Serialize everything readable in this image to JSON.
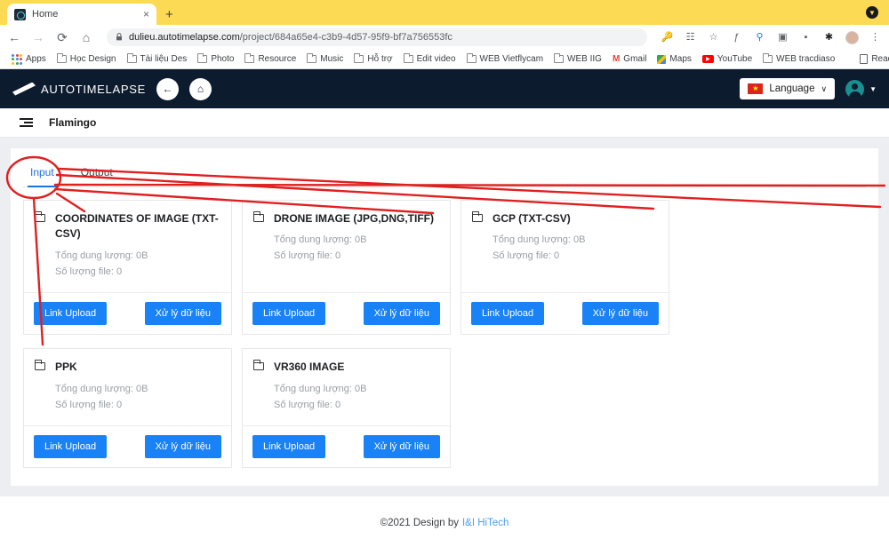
{
  "browser": {
    "tab": {
      "title": "Home",
      "favicon": "globe-icon",
      "close": "×"
    },
    "new_tab": "+",
    "window_menu": "▼",
    "nav": {
      "back": "←",
      "forward": "→",
      "reload": "⟳",
      "home": "⌂"
    },
    "omnibox": {
      "lock": "🔒",
      "host": "dulieu.autotimelapse.com",
      "path": "/project/684a65e4-c3b9-4d57-95f9-bf7a756553fc"
    },
    "toolbar_icons": [
      "key-icon",
      "translate-icon",
      "star-icon",
      "f-script-icon",
      "search-image-icon",
      "camera-icon",
      "paint-icon",
      "extensions-icon",
      "profile-avatar-icon",
      "more-menu-icon"
    ],
    "bookmarks": [
      {
        "label": "Apps",
        "icon": "apps-grid-icon"
      },
      {
        "label": "Học Design",
        "icon": "folder-icon"
      },
      {
        "label": "Tài liệu Des",
        "icon": "folder-icon"
      },
      {
        "label": "Photo",
        "icon": "folder-icon"
      },
      {
        "label": "Resource",
        "icon": "folder-icon"
      },
      {
        "label": "Music",
        "icon": "folder-icon"
      },
      {
        "label": "Hỗ trợ",
        "icon": "folder-icon"
      },
      {
        "label": "Edit video",
        "icon": "folder-icon"
      },
      {
        "label": "WEB Vietflycam",
        "icon": "folder-icon"
      },
      {
        "label": "WEB IIG",
        "icon": "folder-icon"
      },
      {
        "label": "Gmail",
        "icon": "gmail-icon"
      },
      {
        "label": "Maps",
        "icon": "maps-icon"
      },
      {
        "label": "YouTube",
        "icon": "youtube-icon"
      },
      {
        "label": "WEB tracdiaso",
        "icon": "folder-icon"
      }
    ],
    "reading_list": {
      "label": "Reading List",
      "icon": "reading-list-icon"
    }
  },
  "app": {
    "logo_text": "AUTOTIMELAPSE",
    "back_button": "←",
    "home_button": "⌂",
    "language": {
      "label": "Language",
      "caret": "∨",
      "flag": "★"
    },
    "user_caret": "▼"
  },
  "breadcrumb": {
    "menu_icon": "list-menu-icon",
    "title": "Flamingo"
  },
  "main": {
    "tabs": [
      {
        "label": "Input",
        "active": true
      },
      {
        "label": "Output",
        "active": false
      }
    ],
    "cards": [
      {
        "title": "COORDINATES OF IMAGE (TXT-CSV)",
        "total_size": "Tổng dung lượng: 0B",
        "file_count": "Số lượng file: 0",
        "upload_label": "Link Upload",
        "process_label": "Xử lý dữ liệu"
      },
      {
        "title": "DRONE IMAGE (JPG,DNG,TIFF)",
        "total_size": "Tổng dung lượng: 0B",
        "file_count": "Số lượng file: 0",
        "upload_label": "Link Upload",
        "process_label": "Xử lý dữ liệu"
      },
      {
        "title": "GCP (TXT-CSV)",
        "total_size": "Tổng dung lượng: 0B",
        "file_count": "Số lượng file: 0",
        "upload_label": "Link Upload",
        "process_label": "Xử lý dữ liệu"
      },
      {
        "title": "PPK",
        "total_size": "Tổng dung lượng: 0B",
        "file_count": "Số lượng file: 0",
        "upload_label": "Link Upload",
        "process_label": "Xử lý dữ liệu"
      },
      {
        "title": "VR360 IMAGE",
        "total_size": "Tổng dung lượng: 0B",
        "file_count": "Số lượng file: 0",
        "upload_label": "Link Upload",
        "process_label": "Xử lý dữ liệu"
      }
    ]
  },
  "footer": {
    "text": "©2021 Design by",
    "link": "I&I HiTech"
  },
  "annotation": {
    "color": "#e02020"
  },
  "colors": {
    "accent": "#1a73e8",
    "button": "#1a82f7",
    "header_bg": "#0d1b2e",
    "page_bg": "#eceef1",
    "tabstrip": "#fcda53",
    "annotation": "#e02020"
  }
}
